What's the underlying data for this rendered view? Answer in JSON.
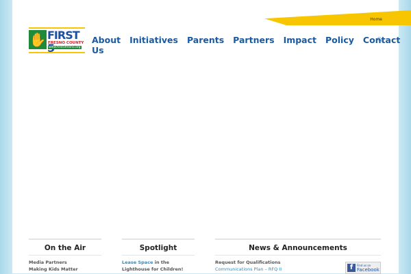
{
  "header": {
    "breadcrumb": "Home",
    "logo": {
      "title": "FIRST 5",
      "subtitle": "FRESNO COUNTY",
      "url": "www.first5fresno.org"
    }
  },
  "nav": [
    "About Us",
    "Initiatives",
    "Parents",
    "Partners",
    "Impact",
    "Policy",
    "Contact"
  ],
  "widgets": {
    "on_air": {
      "title": "On the Air",
      "lines": [
        "Media Partners",
        "Making Kids Matter"
      ]
    },
    "spotlight": {
      "title": "Spotlight",
      "link": "Lease Space",
      "text": " in the Lighthouse for Children!"
    },
    "news": {
      "title": "News & Announcements",
      "item": "Request for Qualifications",
      "link": "Communications Plan – RFQ II",
      "facebook": {
        "small": "Find us on",
        "big": "Facebook"
      }
    }
  }
}
